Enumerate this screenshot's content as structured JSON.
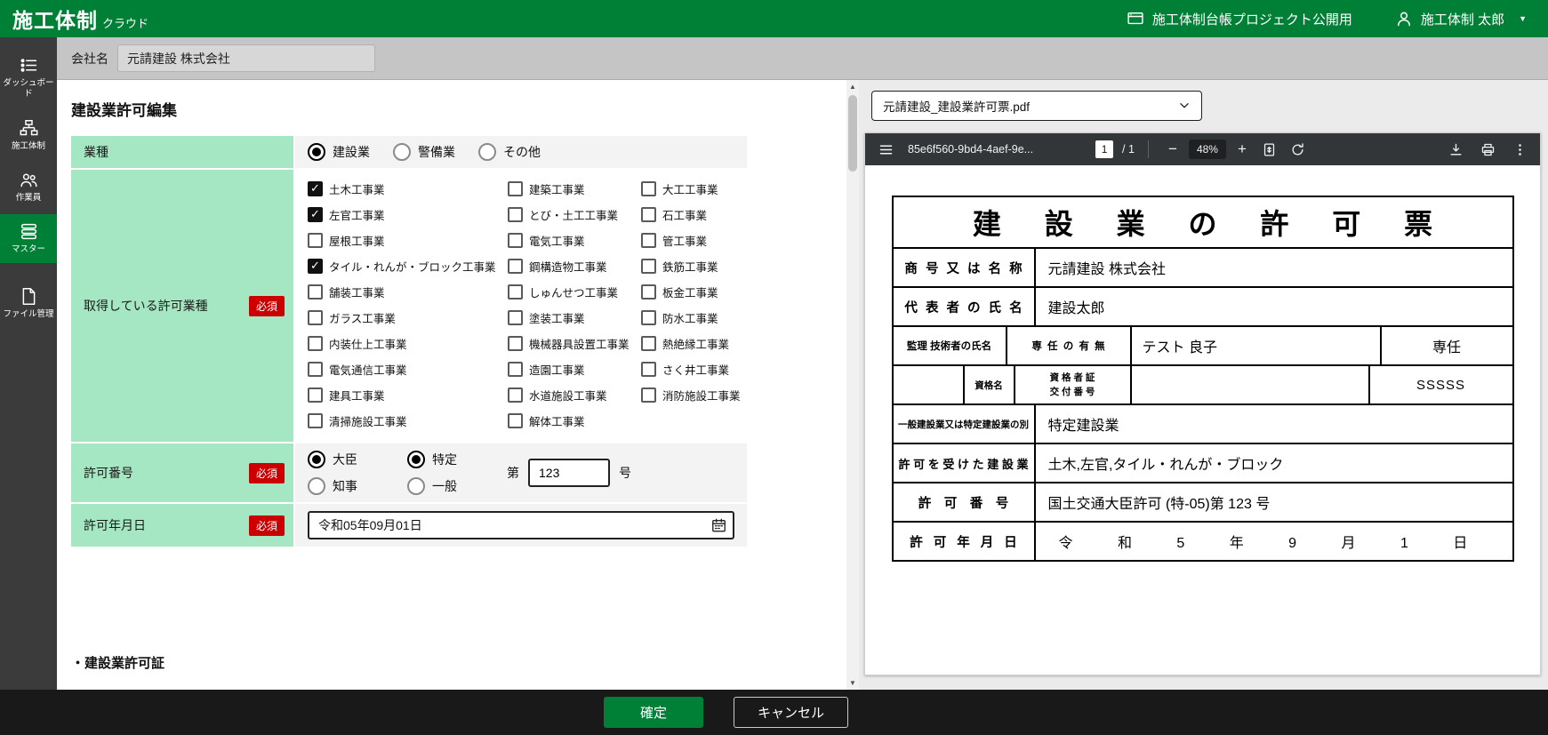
{
  "colors": {
    "brand_green": "#008037",
    "label_green": "#A6E7C3",
    "required_red": "#CC0000",
    "sidebar_dark": "#3B3B3B",
    "footer_dark": "#191919",
    "pdf_toolbar_dark": "#323639"
  },
  "topbar": {
    "logo_main": "施工体制",
    "logo_sub": "クラウド",
    "project_label": "施工体制台帳プロジェクト公開用",
    "user_name": "施工体制 太郎"
  },
  "sidebar": {
    "items": [
      {
        "label": "ダッシュボード"
      },
      {
        "label": "施工体制"
      },
      {
        "label": "作業員"
      },
      {
        "label": "マスター"
      },
      {
        "label": "ファイル管理"
      }
    ]
  },
  "company": {
    "label": "会社名",
    "value": "元請建設 株式会社"
  },
  "form": {
    "title": "建設業許可編集",
    "required_badge": "必須",
    "industry": {
      "label": "業種",
      "options": [
        {
          "label": "建設業",
          "selected": true
        },
        {
          "label": "警備業",
          "selected": false
        },
        {
          "label": "その他",
          "selected": false
        }
      ]
    },
    "licenses": {
      "label": "取得している許可業種",
      "col1": [
        {
          "label": "土木工事業",
          "checked": true
        },
        {
          "label": "左官工事業",
          "checked": true
        },
        {
          "label": "屋根工事業",
          "checked": false
        },
        {
          "label": "タイル・れんが・ブロック工事業",
          "checked": true
        },
        {
          "label": "舗装工事業",
          "checked": false
        },
        {
          "label": "ガラス工事業",
          "checked": false
        },
        {
          "label": "内装仕上工事業",
          "checked": false
        },
        {
          "label": "電気通信工事業",
          "checked": false
        },
        {
          "label": "建具工事業",
          "checked": false
        },
        {
          "label": "清掃施設工事業",
          "checked": false
        }
      ],
      "col2": [
        {
          "label": "建築工事業",
          "checked": false
        },
        {
          "label": "とび・土工工事業",
          "checked": false
        },
        {
          "label": "電気工事業",
          "checked": false
        },
        {
          "label": "鋼構造物工事業",
          "checked": false
        },
        {
          "label": "しゅんせつ工事業",
          "checked": false
        },
        {
          "label": "塗装工事業",
          "checked": false
        },
        {
          "label": "機械器具設置工事業",
          "checked": false
        },
        {
          "label": "造園工事業",
          "checked": false
        },
        {
          "label": "水道施設工事業",
          "checked": false
        },
        {
          "label": "解体工事業",
          "checked": false
        }
      ],
      "col3": [
        {
          "label": "大工工事業",
          "checked": false
        },
        {
          "label": "石工事業",
          "checked": false
        },
        {
          "label": "管工事業",
          "checked": false
        },
        {
          "label": "鉄筋工事業",
          "checked": false
        },
        {
          "label": "板金工事業",
          "checked": false
        },
        {
          "label": "防水工事業",
          "checked": false
        },
        {
          "label": "熱絶縁工事業",
          "checked": false
        },
        {
          "label": "さく井工事業",
          "checked": false
        },
        {
          "label": "消防施設工事業",
          "checked": false
        }
      ]
    },
    "permit_number": {
      "label": "許可番号",
      "minister_options": [
        {
          "label": "大臣",
          "selected": true
        },
        {
          "label": "知事",
          "selected": false
        }
      ],
      "type_options": [
        {
          "label": "特定",
          "selected": true
        },
        {
          "label": "一般",
          "selected": false
        }
      ],
      "prefix": "第",
      "value": "123",
      "suffix": "号"
    },
    "permit_date": {
      "label": "許可年月日",
      "value": "令和05年09月01日"
    },
    "section_below": "・建設業許可証"
  },
  "pdf": {
    "file_select": "元請建設_建設業許可票.pdf",
    "toolbar": {
      "filename": "85e6f560-9bd4-4aef-9e...",
      "page": "1",
      "page_total": "/ 1",
      "zoom": "48%"
    },
    "sheet": {
      "title": "建 設 業 の 許 可 票",
      "trade_name_label": "商 号 又 は 名 称",
      "trade_name_value": "元請建設 株式会社",
      "representative_label": "代 表 者 の 氏 名",
      "representative_value": "建設太郎",
      "engineer_label": "監理 技術者の氏名",
      "fulltime_label": "専 任 の 有 無",
      "engineer_value": "テスト 良子",
      "fulltime_value": "専任",
      "qual_name_label": "資格名",
      "qual_cert_label": "資 格 者 証\n交 付 番 号",
      "qual_cert_value": "SSSSS",
      "class_label": "一般建設業又は特定建設業の別",
      "class_value": "特定建設業",
      "licensed_label": "許 可 を 受 け た 建 設 業",
      "licensed_value": "土木,左官,タイル・れんが・ブロック",
      "number_label": "許　可　番　号",
      "number_value": "国土交通大臣許可 (特-05)第 123 号",
      "date_label": "許 可 年 月 日",
      "date_value": "令 和 5 年 9 月 1 日"
    }
  },
  "footer": {
    "confirm": "確定",
    "cancel": "キャンセル"
  }
}
